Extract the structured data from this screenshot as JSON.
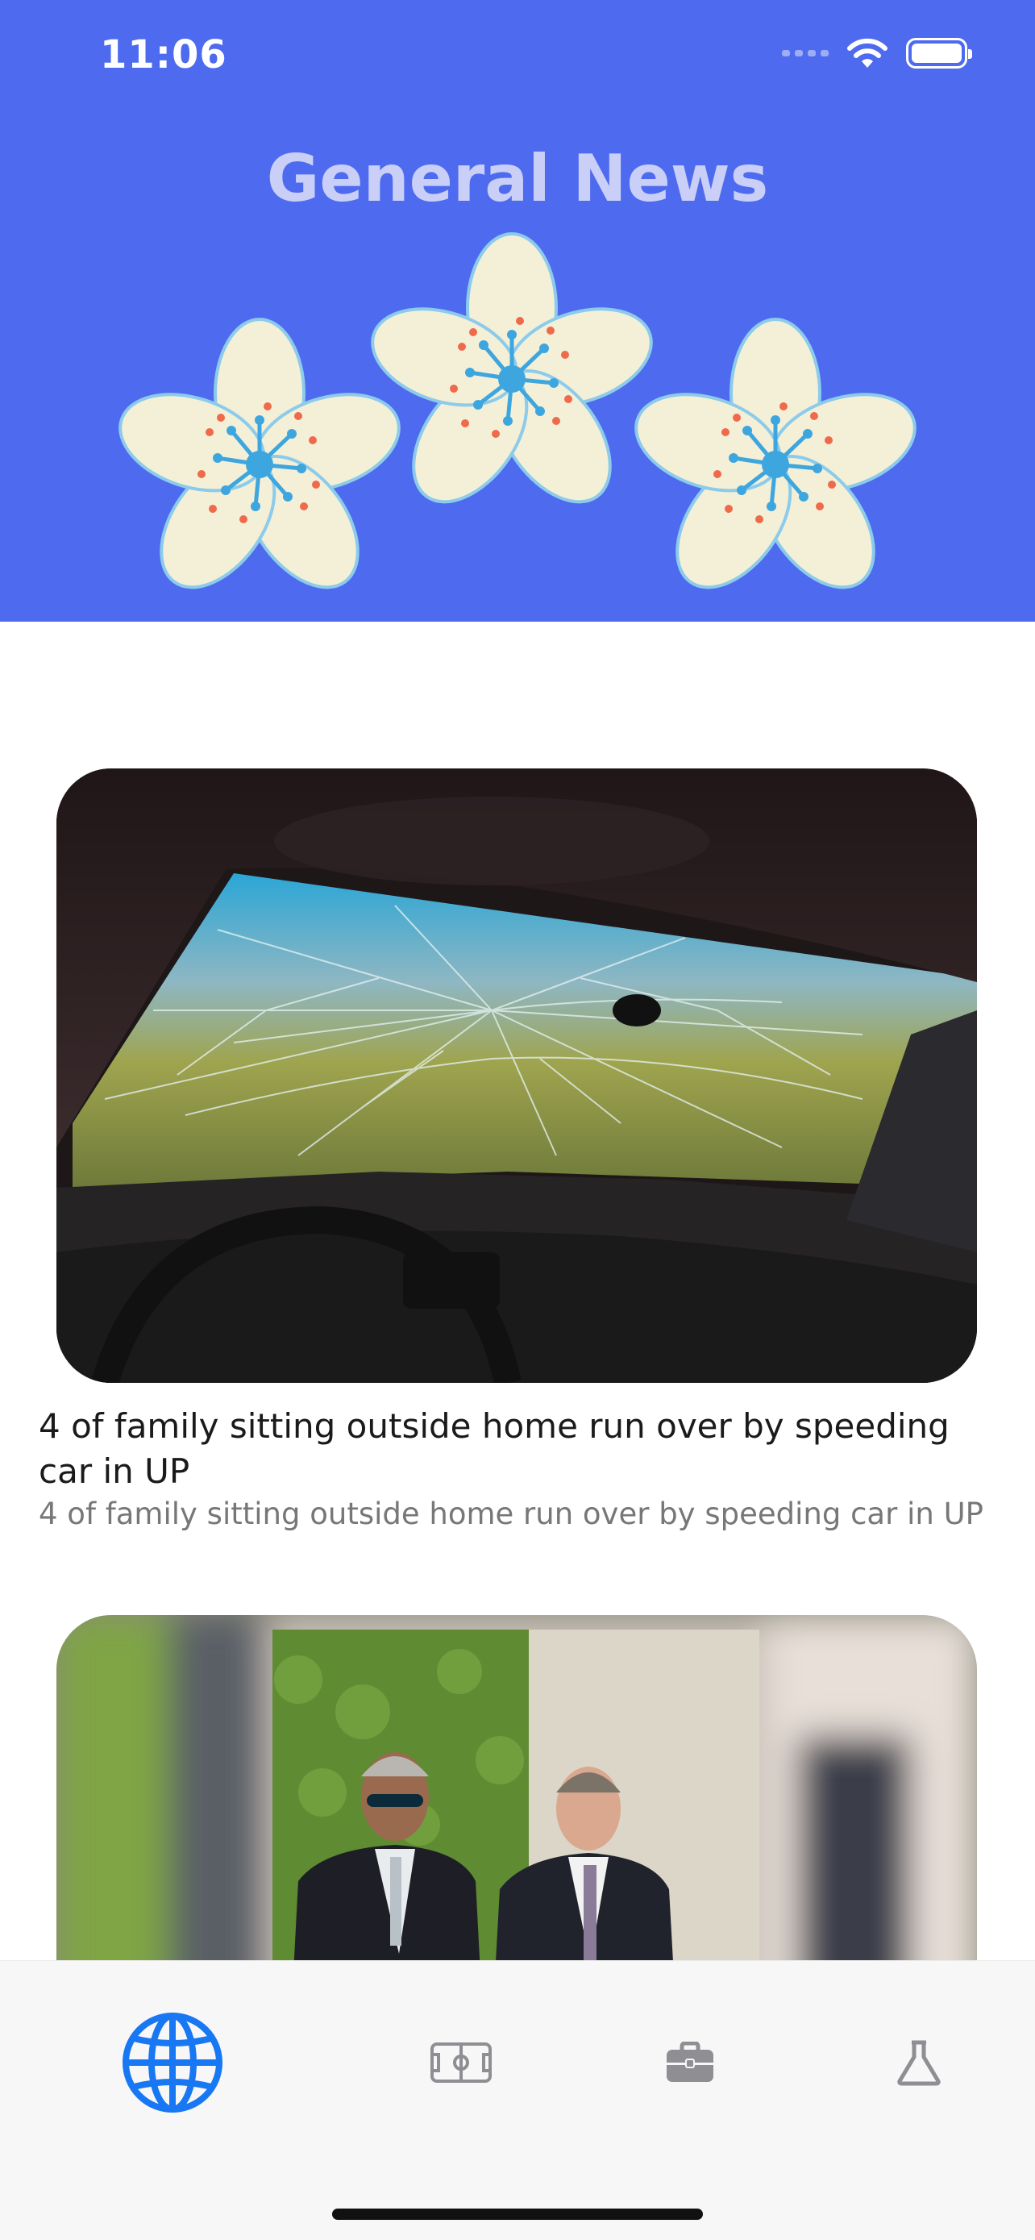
{
  "status_bar": {
    "time": "11:06",
    "icons": [
      "cellular-signal-icon",
      "wifi-icon",
      "battery-icon"
    ]
  },
  "header": {
    "title": "General News",
    "background_color": "#4E6BEF",
    "title_color": "#C9CFF7"
  },
  "articles": [
    {
      "image_alt": "Shattered car windshield viewed from inside the car",
      "headline": "4 of family sitting outside home run over by speeding car in UP",
      "summary": "4 of family sitting outside home run over by speeding car in UP"
    },
    {
      "image_alt": "Two men in suits standing outdoors"
    }
  ],
  "tab_bar": {
    "tabs": [
      {
        "icon": "globe-icon",
        "name": "general",
        "active": true
      },
      {
        "icon": "soccer-field-icon",
        "name": "sports",
        "active": false
      },
      {
        "icon": "briefcase-icon",
        "name": "business",
        "active": false
      },
      {
        "icon": "flask-icon",
        "name": "science",
        "active": false
      }
    ],
    "active_color": "#1877F2",
    "inactive_color": "#8E8E93"
  }
}
